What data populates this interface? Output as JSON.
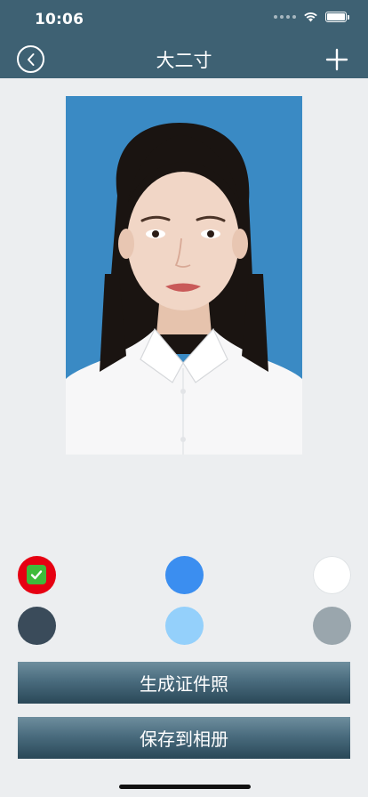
{
  "status_bar": {
    "time": "10:06"
  },
  "nav": {
    "title": "大二寸"
  },
  "background_colors": [
    {
      "color": "#e60012",
      "selected": true
    },
    {
      "color": "#3b8ef0",
      "selected": false
    },
    {
      "color": "#ffffff",
      "selected": false
    },
    {
      "color": "#3a4b5a",
      "selected": false
    },
    {
      "color": "#94d0fb",
      "selected": false
    },
    {
      "color": "#9aa6ad",
      "selected": false
    }
  ],
  "actions": {
    "generate_label": "生成证件照",
    "save_label": "保存到相册"
  },
  "colors": {
    "nav_bar": "#3e6173",
    "photo_background": "#3a8ac4",
    "page_background": "#eceef0"
  }
}
